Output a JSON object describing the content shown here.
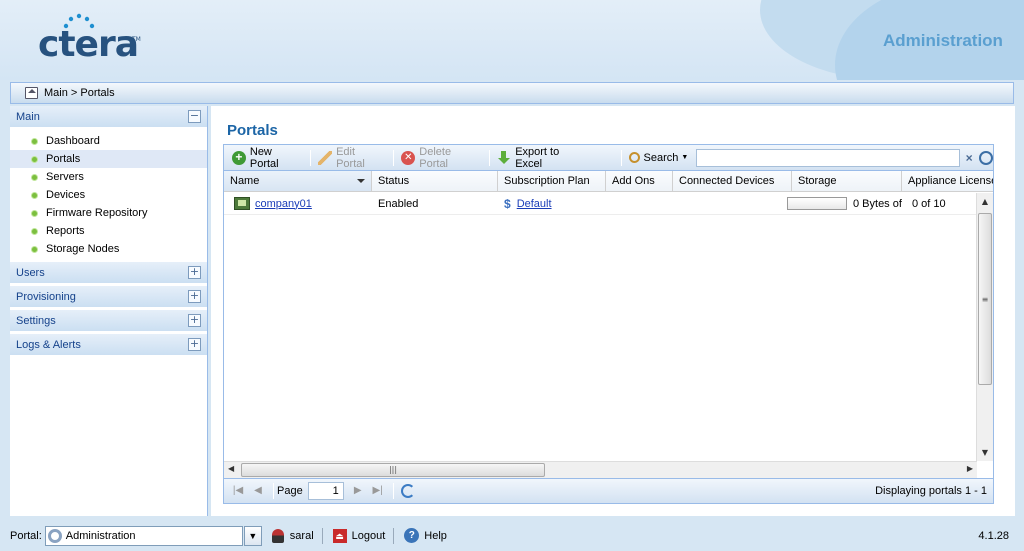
{
  "header": {
    "logo_text": "ctera",
    "logo_tm": "TM",
    "title": "Administration"
  },
  "breadcrumb": {
    "text": "Main > Portals"
  },
  "sidebar": {
    "sections": [
      {
        "label": "Main",
        "expanded": true,
        "toggle": "−"
      },
      {
        "label": "Users",
        "expanded": false,
        "toggle": "+"
      },
      {
        "label": "Provisioning",
        "expanded": false,
        "toggle": "+"
      },
      {
        "label": "Settings",
        "expanded": false,
        "toggle": "+"
      },
      {
        "label": "Logs & Alerts",
        "expanded": false,
        "toggle": "+"
      }
    ],
    "main_items": [
      {
        "label": "Dashboard"
      },
      {
        "label": "Portals",
        "selected": true
      },
      {
        "label": "Servers"
      },
      {
        "label": "Devices"
      },
      {
        "label": "Firmware Repository"
      },
      {
        "label": "Reports"
      },
      {
        "label": "Storage Nodes"
      }
    ]
  },
  "main": {
    "title": "Portals",
    "toolbar": {
      "new_portal": "New Portal",
      "edit_portal": "Edit Portal",
      "delete_portal": "Delete Portal",
      "export": "Export to Excel",
      "search": "Search",
      "search_value": ""
    },
    "columns": [
      "Name",
      "Status",
      "Subscription Plan",
      "Add Ons",
      "Connected Devices",
      "Storage",
      "Appliance Licenses"
    ],
    "rows": [
      {
        "name": "company01",
        "status": "Enabled",
        "plan": "Default",
        "add_ons": "",
        "connected_devices": "",
        "storage_text": "0 Bytes of",
        "storage_fraction": 0,
        "appliance_licenses": "0 of 10"
      }
    ],
    "pager": {
      "page_label": "Page",
      "page_value": "1",
      "info": "Displaying portals 1 - 1"
    }
  },
  "footer": {
    "portal_label": "Portal:",
    "portal_value": "Administration",
    "user": "saral",
    "logout": "Logout",
    "help": "Help",
    "version": "4.1.28"
  },
  "colors": {
    "accent": "#1c65a6",
    "header_title": "#5a9fd0",
    "link": "#1a3db8",
    "nav_dot": "#7cbf3f"
  }
}
